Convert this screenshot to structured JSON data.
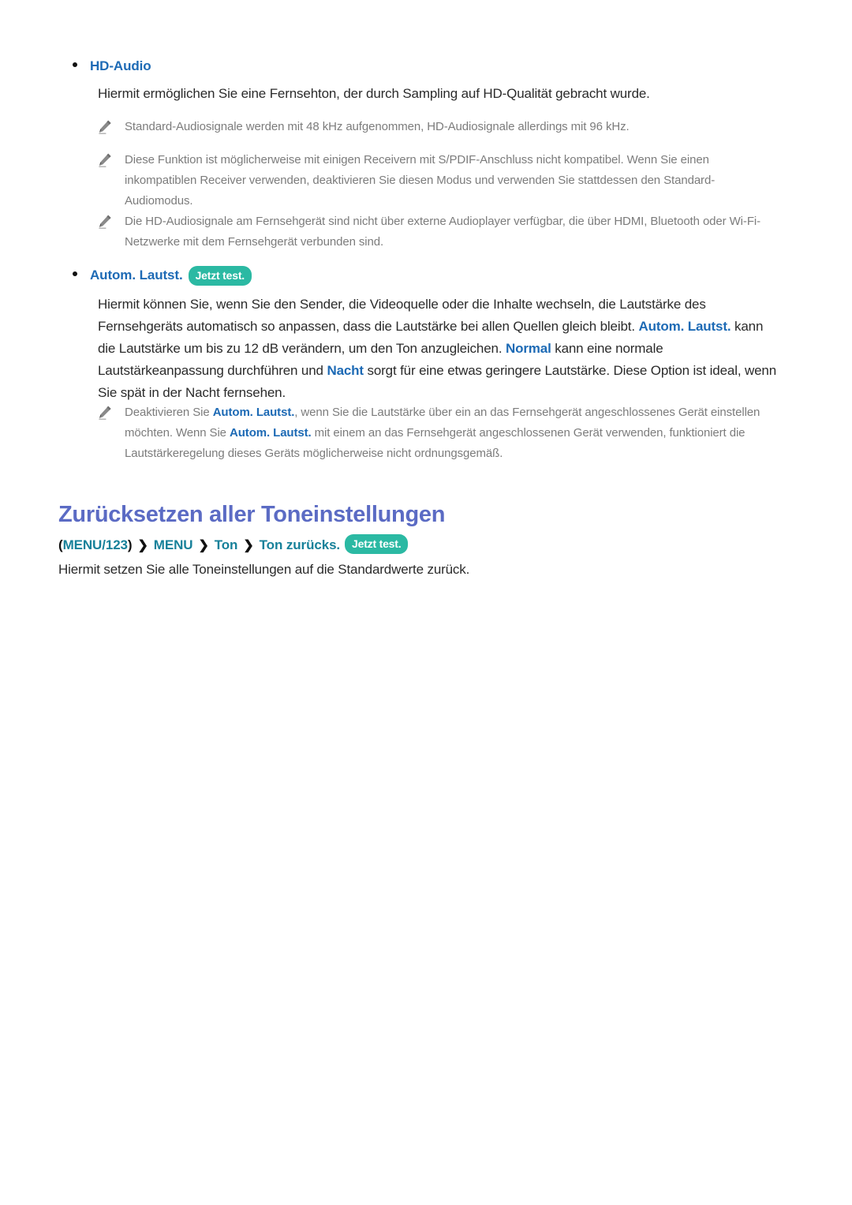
{
  "page": {
    "background": "#ffffff",
    "body_text_color": "#2b2b2b",
    "note_text_color": "#7c7c7c",
    "link_blue": "#1d6ab5",
    "heading_purple": "#5b6bc4",
    "breadcrumb_teal": "#17819a",
    "pill_green": "#2bb9a3"
  },
  "hd_audio": {
    "bullet_label": "HD-Audio",
    "description": "Hiermit ermöglichen Sie eine Fernsehton, der durch Sampling auf HD-Qualität gebracht wurde.",
    "notes": [
      "Standard-Audiosignale werden mit 48 kHz aufgenommen, HD-Audiosignale allerdings mit 96 kHz.",
      "Diese Funktion ist möglicherweise mit einigen Receivern mit S/PDIF-Anschluss nicht kompatibel. Wenn Sie einen inkompatiblen Receiver verwenden, deaktivieren Sie diesen Modus und verwenden Sie stattdessen den Standard-Audiomodus.",
      "Die HD-Audiosignale am Fernsehgerät sind nicht über externe Audioplayer verfügbar, die über HDMI, Bluetooth oder Wi-Fi-Netzwerke mit dem Fernsehgerät verbunden sind."
    ]
  },
  "autom_lautst": {
    "bullet_label": "Autom. Lautst.",
    "pill_label": "Jetzt test.",
    "paragraph": {
      "part1": "Hiermit können Sie, wenn Sie den Sender, die Videoquelle oder die Inhalte wechseln, die Lautstärke des Fernsehgeräts automatisch so anpassen, dass die Lautstärke bei allen Quellen gleich bleibt. ",
      "hl1": "Autom. Lautst.",
      "part2": " kann die Lautstärke um bis zu 12 dB verändern, um den Ton anzugleichen. ",
      "hl2": "Normal",
      "part3": " kann eine normale Lautstärkeanpassung durchführen und ",
      "hl3": "Nacht",
      "part4": " sorgt für eine etwas geringere Lautstärke. Diese Option ist ideal, wenn Sie spät in der Nacht fernsehen."
    },
    "note": {
      "part1": "Deaktivieren Sie ",
      "hl1": "Autom. Lautst.",
      "part2": ", wenn Sie die Lautstärke über ein an das Fernsehgerät angeschlossenes Gerät einstellen möchten. Wenn Sie ",
      "hl2": "Autom. Lautst.",
      "part3": " mit einem an das Fernsehgerät angeschlossenen Gerät verwenden, funktioniert die Lautstärkeregelung dieses Geräts möglicherweise nicht ordnungsgemäß."
    }
  },
  "reset_section": {
    "title": "Zurücksetzen aller Toneinstellungen",
    "breadcrumb": {
      "open_paren": "(",
      "close_paren": ")",
      "items": [
        "MENU/123",
        "MENU",
        "Ton",
        "Ton zurücks."
      ],
      "separator": "❯",
      "pill_label": "Jetzt test."
    },
    "description": "Hiermit setzen Sie alle Toneinstellungen auf die Standardwerte zurück."
  }
}
